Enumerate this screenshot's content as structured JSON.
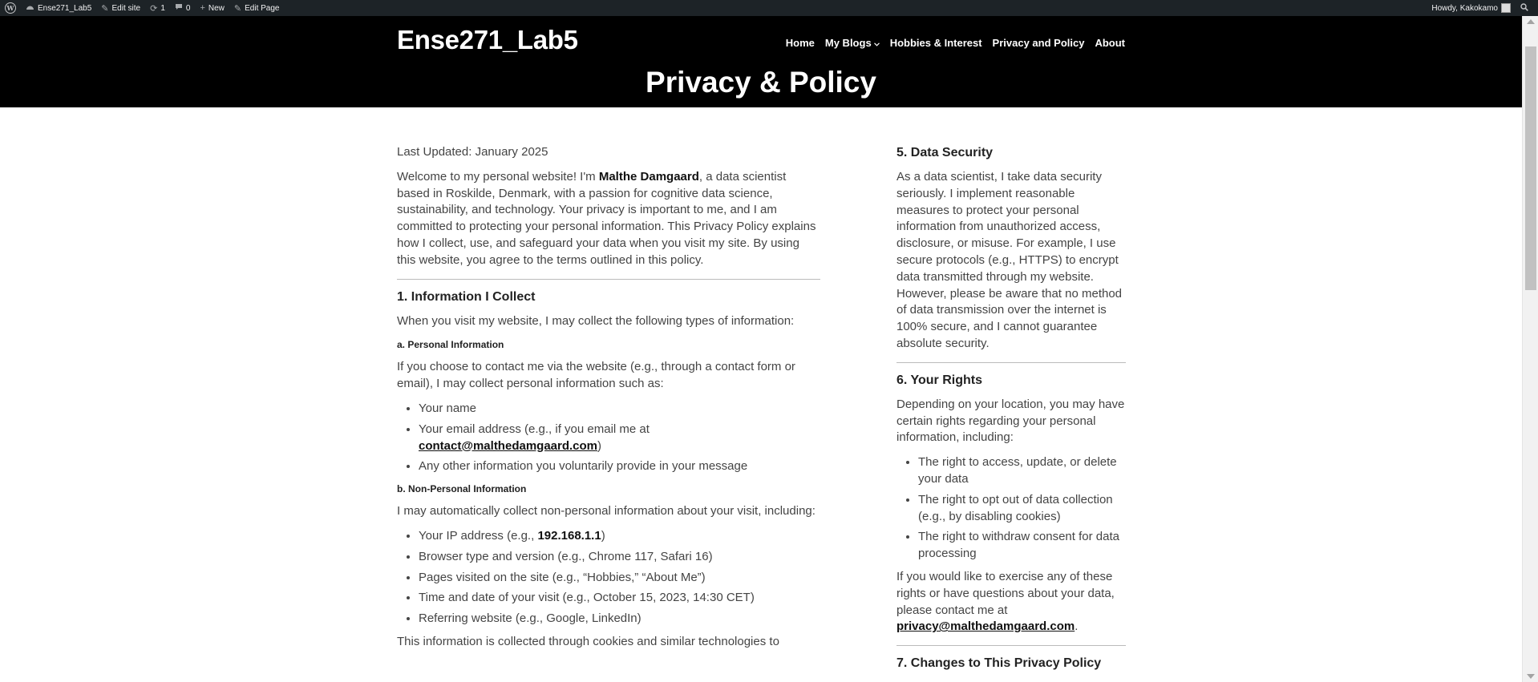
{
  "adminbar": {
    "site_name": "Ense271_Lab5",
    "edit_site": "Edit site",
    "updates_count": "1",
    "comments_count": "0",
    "new_label": "New",
    "edit_page": "Edit Page",
    "howdy": "Howdy, Kakokamo"
  },
  "header": {
    "site_title": "Ense271_Lab5",
    "nav": [
      "Home",
      "My Blogs",
      "Hobbies & Interest",
      "Privacy and Policy",
      "About"
    ],
    "page_title": "Privacy & Policy"
  },
  "left": {
    "last_updated": "Last Updated: January 2025",
    "intro_pre": "Welcome to my personal website! I'm ",
    "intro_name": "Malthe Damgaard",
    "intro_post": ", a data scientist based in Roskilde, Denmark, with a passion for cognitive data science, sustainability, and technology. Your privacy is important to me, and I am committed to protecting your personal information. This Privacy Policy explains how I collect, use, and safeguard your data when you visit my site. By using this website, you agree to the terms outlined in this policy.",
    "s1_title": "1. Information I Collect",
    "s1_intro": "When you visit my website, I may collect the following types of information:",
    "s1a_title": "a. Personal Information",
    "s1a_text": "If you choose to contact me via the website (e.g., through a contact form or email), I may collect personal information such as:",
    "s1a_item1": "Your name",
    "s1a_item2_pre": "Your email address (e.g., if you email me at ",
    "s1a_item2_email": "contact@malthedamgaard.com",
    "s1a_item2_post": ")",
    "s1a_item3": "Any other information you voluntarily provide in your message",
    "s1b_title": "b. Non-Personal Information",
    "s1b_text": "I may automatically collect non-personal information about your visit, including:",
    "s1b_item1_pre": "Your IP address (e.g., ",
    "s1b_item1_ip": "192.168.1.1",
    "s1b_item1_post": ")",
    "s1b_item2": "Browser type and version (e.g., Chrome 117, Safari 16)",
    "s1b_item3": "Pages visited on the site (e.g., “Hobbies,” “About Me”)",
    "s1b_item4": "Time and date of your visit (e.g., October 15, 2023, 14:30 CET)",
    "s1b_item5": "Referring website (e.g., Google, LinkedIn)",
    "s1b_footer": "This information is collected through cookies and similar technologies to"
  },
  "right": {
    "s5_title": "5. Data Security",
    "s5_text": "As a data scientist, I take data security seriously. I implement reasonable measures to protect your personal information from unauthorized access, disclosure, or misuse. For example, I use secure protocols (e.g., HTTPS) to encrypt data transmitted through my website. However, please be aware that no method of data transmission over the internet is 100% secure, and I cannot guarantee absolute security.",
    "s6_title": "6. Your Rights",
    "s6_text": "Depending on your location, you may have certain rights regarding your personal information, including:",
    "s6_item1": "The right to access, update, or delete your data",
    "s6_item2": "The right to opt out of data collection (e.g., by disabling cookies)",
    "s6_item3": "The right to withdraw consent for data processing",
    "s6_contact_pre": "If you would like to exercise any of these rights or have questions about your data, please contact me at ",
    "s6_contact_email": "privacy@malthedamgaard.com",
    "s6_contact_post": ".",
    "s7_title": "7. Changes to This Privacy Policy"
  }
}
